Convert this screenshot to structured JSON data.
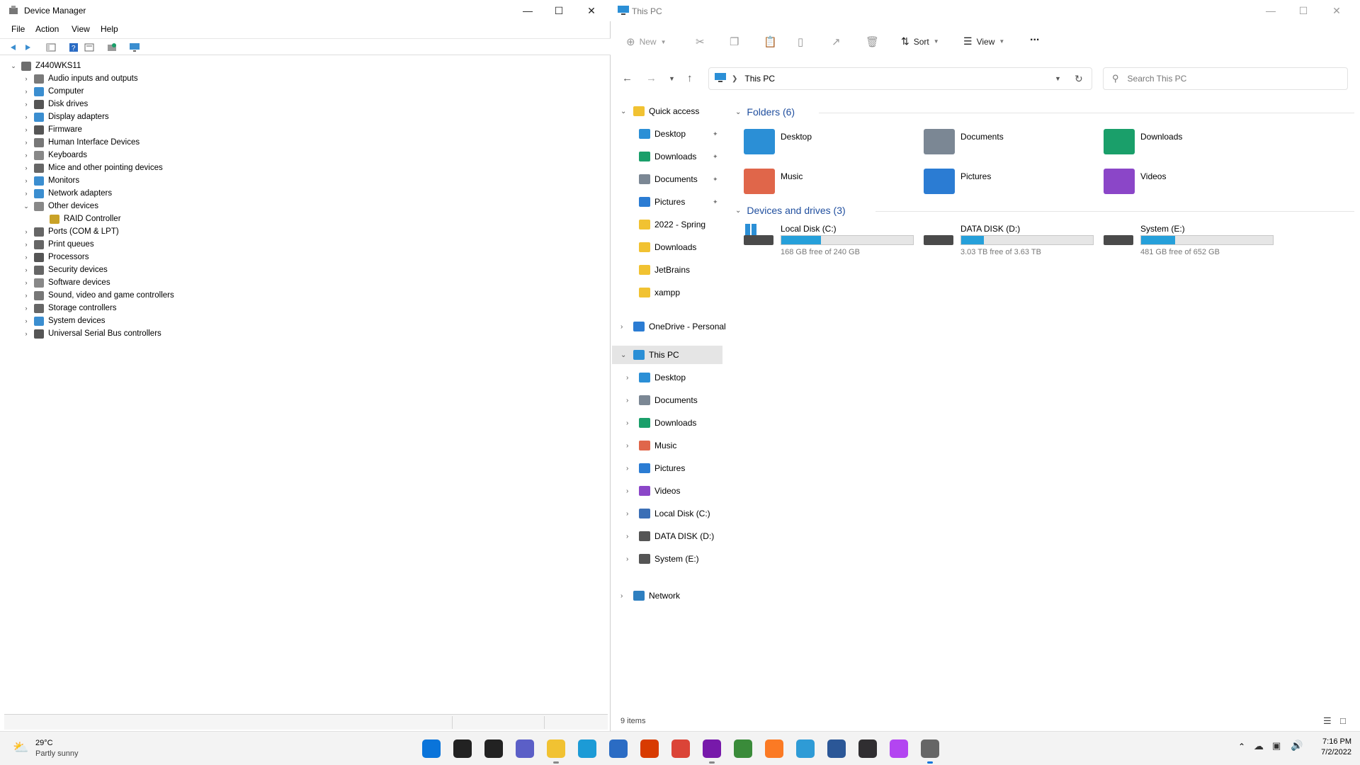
{
  "device_manager": {
    "title": "Device Manager",
    "menu": [
      "File",
      "Action",
      "View",
      "Help"
    ],
    "root": "Z440WKS11",
    "categories": [
      {
        "label": "Audio inputs and outputs",
        "icon": "speaker-icon",
        "color": "#7a7a7a"
      },
      {
        "label": "Computer",
        "icon": "computer-icon",
        "color": "#3b8ed0"
      },
      {
        "label": "Disk drives",
        "icon": "disk-drive-icon",
        "color": "#555555"
      },
      {
        "label": "Display adapters",
        "icon": "display-adapter-icon",
        "color": "#3b8ed0"
      },
      {
        "label": "Firmware",
        "icon": "firmware-icon",
        "color": "#555555"
      },
      {
        "label": "Human Interface Devices",
        "icon": "hid-icon",
        "color": "#777777"
      },
      {
        "label": "Keyboards",
        "icon": "keyboard-icon",
        "color": "#888888"
      },
      {
        "label": "Mice and other pointing devices",
        "icon": "mouse-icon",
        "color": "#666666"
      },
      {
        "label": "Monitors",
        "icon": "monitor-icon",
        "color": "#3b8ed0"
      },
      {
        "label": "Network adapters",
        "icon": "network-adapter-icon",
        "color": "#3b8ed0"
      },
      {
        "label": "Other devices",
        "icon": "unknown-device-icon",
        "color": "#888888",
        "expanded": true
      },
      {
        "label": "RAID Controller",
        "icon": "warning-device-icon",
        "color": "#c9a227",
        "child": true
      },
      {
        "label": "Ports (COM & LPT)",
        "icon": "port-icon",
        "color": "#666666"
      },
      {
        "label": "Print queues",
        "icon": "printer-icon",
        "color": "#666666"
      },
      {
        "label": "Processors",
        "icon": "processor-icon",
        "color": "#555555"
      },
      {
        "label": "Security devices",
        "icon": "security-device-icon",
        "color": "#666666"
      },
      {
        "label": "Software devices",
        "icon": "software-device-icon",
        "color": "#888888"
      },
      {
        "label": "Sound, video and game controllers",
        "icon": "sound-icon",
        "color": "#777777"
      },
      {
        "label": "Storage controllers",
        "icon": "storage-controller-icon",
        "color": "#666666"
      },
      {
        "label": "System devices",
        "icon": "system-device-icon",
        "color": "#3b8ed0"
      },
      {
        "label": "Universal Serial Bus controllers",
        "icon": "usb-icon",
        "color": "#555555"
      }
    ]
  },
  "explorer": {
    "title": "This PC",
    "commands": {
      "new": "New",
      "sort": "Sort",
      "view": "View",
      "more": "..."
    },
    "address": "This PC",
    "search_placeholder": "Search This PC",
    "nav": {
      "quick_access": "Quick access",
      "quick_items": [
        {
          "label": "Desktop",
          "color": "#2b8fd6",
          "pinned": true
        },
        {
          "label": "Downloads",
          "color": "#1a9f6a",
          "pinned": true
        },
        {
          "label": "Documents",
          "color": "#7b8794",
          "pinned": true
        },
        {
          "label": "Pictures",
          "color": "#2b7cd3",
          "pinned": true
        },
        {
          "label": "2022 - Spring",
          "color": "#f1c232",
          "pinned": false
        },
        {
          "label": "Downloads",
          "color": "#f1c232",
          "pinned": false
        },
        {
          "label": "JetBrains",
          "color": "#f1c232",
          "pinned": false
        },
        {
          "label": "xampp",
          "color": "#f1c232",
          "pinned": false
        }
      ],
      "onedrive": "OneDrive - Personal",
      "this_pc": "This PC",
      "this_pc_items": [
        {
          "label": "Desktop",
          "color": "#2b8fd6"
        },
        {
          "label": "Documents",
          "color": "#7b8794"
        },
        {
          "label": "Downloads",
          "color": "#1a9f6a"
        },
        {
          "label": "Music",
          "color": "#e0664a"
        },
        {
          "label": "Pictures",
          "color": "#2b7cd3"
        },
        {
          "label": "Videos",
          "color": "#8b46c8"
        },
        {
          "label": "Local Disk (C:)",
          "color": "#3b6fb6"
        },
        {
          "label": "DATA DISK (D:)",
          "color": "#555555"
        },
        {
          "label": "System (E:)",
          "color": "#555555"
        }
      ],
      "network": "Network"
    },
    "folders_header": "Folders (6)",
    "folders": [
      {
        "label": "Desktop",
        "color": "#2b8fd6"
      },
      {
        "label": "Documents",
        "color": "#7b8794"
      },
      {
        "label": "Downloads",
        "color": "#1a9f6a"
      },
      {
        "label": "Music",
        "color": "#e0664a"
      },
      {
        "label": "Pictures",
        "color": "#2b7cd3"
      },
      {
        "label": "Videos",
        "color": "#8b46c8"
      }
    ],
    "drives_header": "Devices and drives (3)",
    "drives": [
      {
        "label": "Local Disk (C:)",
        "space": "168 GB free of 240 GB",
        "used_fraction": 0.3
      },
      {
        "label": "DATA DISK (D:)",
        "space": "3.03 TB free of 3.63 TB",
        "used_fraction": 0.17
      },
      {
        "label": "System (E:)",
        "space": "481 GB free of 652 GB",
        "used_fraction": 0.26
      }
    ],
    "status": "9 items"
  },
  "taskbar": {
    "weather_temp": "29°C",
    "weather_desc": "Partly sunny",
    "time": "7:16 PM",
    "date": "7/2/2022",
    "apps": [
      {
        "name": "start-icon",
        "color": "#0a74da"
      },
      {
        "name": "search-icon",
        "color": "#222222"
      },
      {
        "name": "task-view-icon",
        "color": "#222222"
      },
      {
        "name": "chat-icon",
        "color": "#5b5fc7"
      },
      {
        "name": "file-explorer-icon",
        "color": "#f1c232"
      },
      {
        "name": "edge-icon",
        "color": "#1c9bd6"
      },
      {
        "name": "store-icon",
        "color": "#2b6cc4"
      },
      {
        "name": "office-icon",
        "color": "#d83b01"
      },
      {
        "name": "chrome-icon",
        "color": "#db4437"
      },
      {
        "name": "onenote-icon",
        "color": "#7719aa"
      },
      {
        "name": "paint-icon",
        "color": "#3a8b3a"
      },
      {
        "name": "xampp-icon",
        "color": "#fb7a24"
      },
      {
        "name": "globe-app-icon",
        "color": "#2e9bd6"
      },
      {
        "name": "powershell-icon",
        "color": "#2b5797"
      },
      {
        "name": "obs-icon",
        "color": "#302e31"
      },
      {
        "name": "phpstorm-icon",
        "color": "#b345f1"
      },
      {
        "name": "device-manager-icon",
        "color": "#666666"
      }
    ]
  }
}
